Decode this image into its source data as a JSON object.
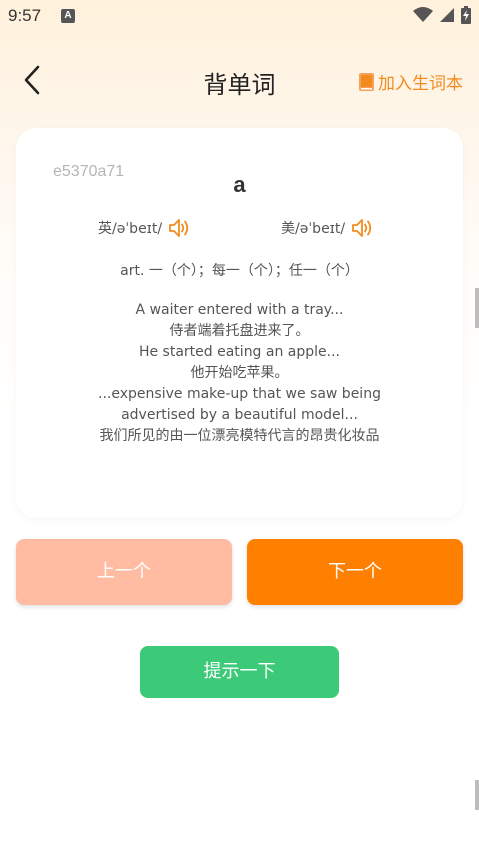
{
  "status_bar": {
    "time": "9:57",
    "notification_letter": "A",
    "icons": [
      "wifi-icon",
      "signal-icon",
      "battery-charging-icon"
    ]
  },
  "header": {
    "title": "背单词",
    "back_icon": "chevron-left-icon",
    "add_label": "加入生词本",
    "add_icon": "book-icon",
    "accent_color": "#f28b1e"
  },
  "card": {
    "word_id": "e5370a71",
    "word": "a",
    "phonetic_uk": "英/əˈbeɪt/",
    "phonetic_us": "美/əˈbeɪt/",
    "speaker_icon": "speaker-icon",
    "meaning": "art. 一（个）；每一（个）；任一（个）",
    "examples": [
      "A waiter entered with a tray...",
      "侍者端着托盘进来了。",
      "He started eating an apple...",
      "他开始吃苹果。",
      "...expensive make-up that we saw being advertised by a beautiful model...",
      "我们所见的由一位漂亮模特代言的昂贵化妆品"
    ]
  },
  "buttons": {
    "prev_label": "上一个",
    "next_label": "下一个",
    "hint_label": "提示一下",
    "colors": {
      "prev": "#ffbca3",
      "next": "#ff7f00",
      "hint": "#3cc978"
    }
  }
}
